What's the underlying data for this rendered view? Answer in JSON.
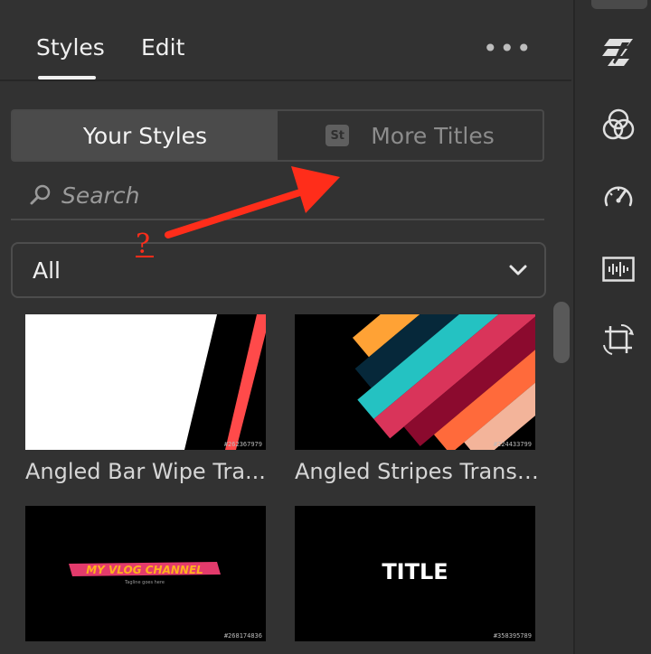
{
  "tabs": {
    "styles": "Styles",
    "edit": "Edit"
  },
  "overflow_menu": "•••",
  "segmented": {
    "your_styles": "Your Styles",
    "more_titles": "More Titles",
    "stock_badge": "St"
  },
  "search": {
    "placeholder": "Search"
  },
  "filter": {
    "selected": "All"
  },
  "cards": [
    {
      "label": "Angled Bar Wipe Tra...",
      "id": "#262367979"
    },
    {
      "label": "Angled Stripes Transit...",
      "id": "#224433799"
    },
    {
      "label": "",
      "id": "#268174836",
      "logo_text": "MY VLOG CHANNEL",
      "tagline": "Tagline goes here"
    },
    {
      "label": "",
      "id": "#358395789",
      "title_text": "TITLE"
    }
  ],
  "annotation": {
    "mark": "?",
    "color": "#ff2d1a"
  },
  "rail_icons": [
    "motion-blur-icon",
    "color-circles-icon",
    "speedometer-icon",
    "audio-waveform-icon",
    "crop-rotate-icon"
  ]
}
